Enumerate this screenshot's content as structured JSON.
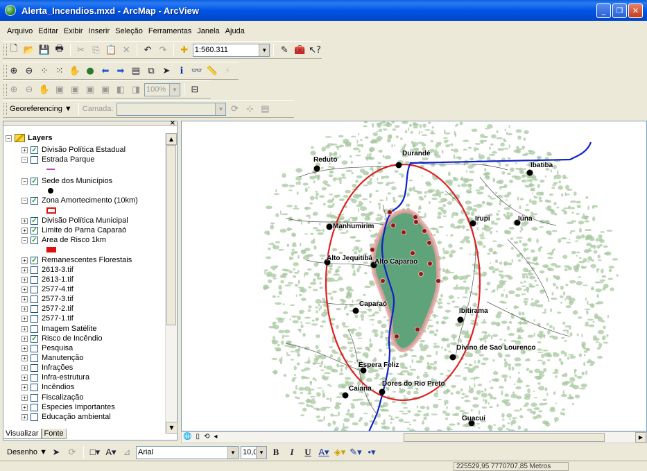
{
  "window": {
    "title": "Alerta_Incendios.mxd - ArcMap - ArcView",
    "buttons": [
      "_",
      "❐",
      "✕"
    ]
  },
  "menu": [
    "Arquivo",
    "Editar",
    "Exibir",
    "Inserir",
    "Seleção",
    "Ferramentas",
    "Janela",
    "Ajuda"
  ],
  "standard_toolbar": {
    "scale": "1:560.311"
  },
  "georef_toolbar": {
    "label": "Georeferencing ▼",
    "layer_label": "Camada:",
    "layer_value": ""
  },
  "zoom_box": "100%",
  "toc": {
    "root": "Layers",
    "items": [
      {
        "label": "Divisão Política Estadual",
        "checked": true,
        "expand": "+"
      },
      {
        "label": "Estrada Parque",
        "checked": false,
        "expand": "−"
      },
      {
        "label": "Sede dos Municípios",
        "checked": true,
        "expand": "−"
      },
      {
        "label": "Zona Amortecimento (10km)",
        "checked": true,
        "expand": "−"
      },
      {
        "label": "Divisão Política Municipal",
        "checked": true,
        "expand": "+"
      },
      {
        "label": "Limite do Parna Caparaó",
        "checked": true,
        "expand": "+"
      },
      {
        "label": "Area de Risco 1km",
        "checked": true,
        "expand": "−"
      },
      {
        "label": "Remanescentes Florestais",
        "checked": true,
        "expand": "+"
      },
      {
        "label": "2613-3.tif",
        "checked": false,
        "expand": "+"
      },
      {
        "label": "2613-1.tif",
        "checked": false,
        "expand": "+"
      },
      {
        "label": "2577-4.tif",
        "checked": false,
        "expand": "+"
      },
      {
        "label": "2577-3.tif",
        "checked": false,
        "expand": "+"
      },
      {
        "label": "2577-2.tif",
        "checked": false,
        "expand": "+"
      },
      {
        "label": "2577-1.tif",
        "checked": false,
        "expand": "+"
      },
      {
        "label": "Imagem Satélite",
        "checked": false,
        "expand": "+"
      },
      {
        "label": "Risco de Incêndio",
        "checked": true,
        "expand": "+"
      },
      {
        "label": "Pesquisa",
        "checked": false,
        "expand": "+"
      },
      {
        "label": "Manutenção",
        "checked": false,
        "expand": "+"
      },
      {
        "label": "Infrações",
        "checked": false,
        "expand": "+"
      },
      {
        "label": "Infra-estrutura",
        "checked": false,
        "expand": "+"
      },
      {
        "label": "Incêndios",
        "checked": false,
        "expand": "+"
      },
      {
        "label": "Fiscalização",
        "checked": false,
        "expand": "+"
      },
      {
        "label": "Especies Importantes",
        "checked": false,
        "expand": "+"
      },
      {
        "label": "Educação ambiental",
        "checked": false,
        "expand": "+"
      }
    ],
    "tabs": [
      "Visualizar",
      "Fonte"
    ]
  },
  "map": {
    "cities": [
      "Durandé",
      "Reduto",
      "Ibatiba",
      "Manhumirim",
      "Iúna",
      "Irupi",
      "Alto Jequitibá",
      "Alto Caparao",
      "Caparaó",
      "Ibitirama",
      "Divino de Sao Lourenco",
      "Espera Feliz",
      "Dores do Rio Preto",
      "Caiana",
      "Guacuí"
    ],
    "colors": {
      "forest": "#a8c8a0",
      "park": "#5fa37a",
      "buffer": "#e02020",
      "border": "#1020c8"
    }
  },
  "draw_toolbar": {
    "label": "Desenho ▼",
    "font": "Arial",
    "size": "10,0",
    "bold": "B",
    "italic": "I",
    "underline": "U"
  },
  "status": {
    "coords": "225529,95  7770707,85 Metros"
  }
}
